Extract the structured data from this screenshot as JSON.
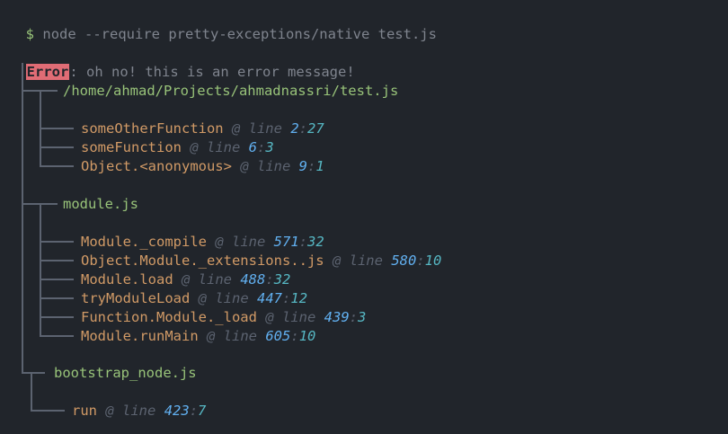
{
  "prompt": {
    "symbol": "$",
    "command": "node --require pretty-exceptions/native test.js"
  },
  "error": {
    "label": "Error",
    "separator": ":",
    "message": "oh no! this is an error message!"
  },
  "at_label": "@ line",
  "colon": ":",
  "groups": [
    {
      "file": "/home/ahmad/Projects/ahmadnassri/test.js",
      "frames": [
        {
          "fn": "someOtherFunction",
          "line": "2",
          "col": "27"
        },
        {
          "fn": "someFunction",
          "line": "6",
          "col": "3"
        },
        {
          "fn": "Object.<anonymous>",
          "line": "9",
          "col": "1"
        }
      ]
    },
    {
      "file": "module.js",
      "frames": [
        {
          "fn": "Module._compile",
          "line": "571",
          "col": "32"
        },
        {
          "fn": "Object.Module._extensions..js",
          "line": "580",
          "col": "10"
        },
        {
          "fn": "Module.load",
          "line": "488",
          "col": "32"
        },
        {
          "fn": "tryModuleLoad",
          "line": "447",
          "col": "12"
        },
        {
          "fn": "Function.Module._load",
          "line": "439",
          "col": "3"
        },
        {
          "fn": "Module.runMain",
          "line": "605",
          "col": "10"
        }
      ]
    },
    {
      "file": "bootstrap_node.js",
      "frames": [
        {
          "fn": "run",
          "line": "423",
          "col": "7"
        }
      ]
    }
  ]
}
